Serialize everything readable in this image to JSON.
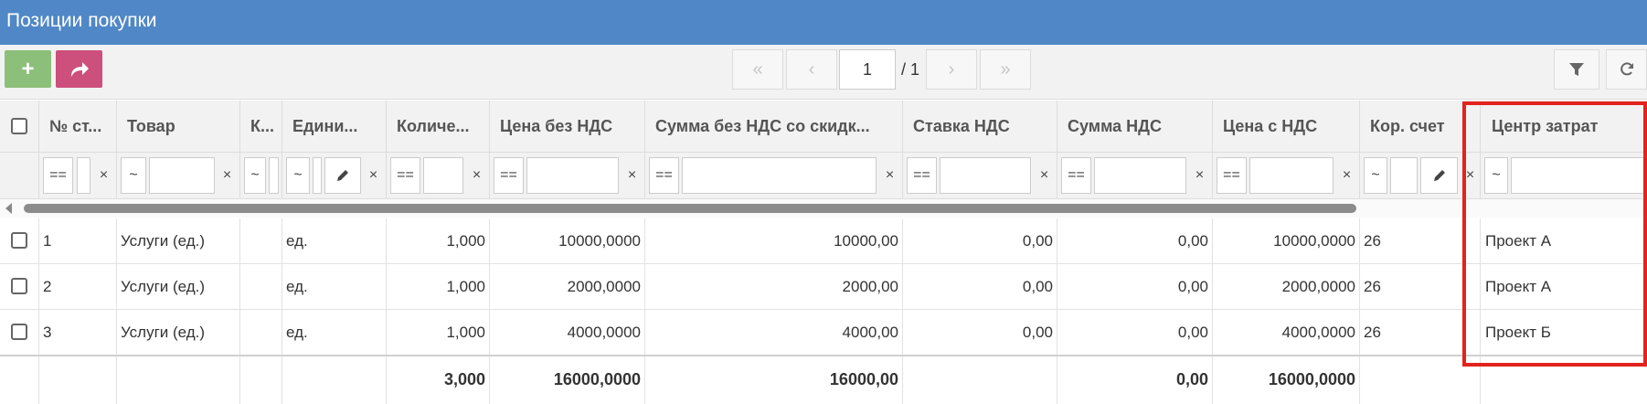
{
  "title": "Позиции покупки",
  "toolbar": {
    "add_symbol": "+",
    "forward_symbol": "↱",
    "pager": {
      "first": "«",
      "prev": "‹",
      "page": "1",
      "total": "/ 1",
      "next": "›",
      "last": "»"
    }
  },
  "columns": [
    "№ ст...",
    "Товар",
    "К...",
    "Едини...",
    "Количе...",
    "Цена без НДС",
    "Сумма без НДС со скидк...",
    "Ставка НДС",
    "Сумма НДС",
    "Цена с НДС",
    "Кор. счет",
    "Центр затрат"
  ],
  "filters": {
    "eq": "==",
    "like": "~",
    "clear": "×"
  },
  "rows": [
    {
      "num": "1",
      "item": "Услуги (ед.)",
      "k": "",
      "unit": "ед.",
      "qty": "1,000",
      "price": "10000,0000",
      "sum": "10000,00",
      "rate": "0,00",
      "vat": "0,00",
      "price_vat": "10000,0000",
      "account": "26",
      "cost_center": "Проект А"
    },
    {
      "num": "2",
      "item": "Услуги (ед.)",
      "k": "",
      "unit": "ед.",
      "qty": "1,000",
      "price": "2000,0000",
      "sum": "2000,00",
      "rate": "0,00",
      "vat": "0,00",
      "price_vat": "2000,0000",
      "account": "26",
      "cost_center": "Проект А"
    },
    {
      "num": "3",
      "item": "Услуги (ед.)",
      "k": "",
      "unit": "ед.",
      "qty": "1,000",
      "price": "4000,0000",
      "sum": "4000,00",
      "rate": "0,00",
      "vat": "0,00",
      "price_vat": "4000,0000",
      "account": "26",
      "cost_center": "Проект Б"
    }
  ],
  "totals": {
    "qty": "3,000",
    "price": "16000,0000",
    "sum": "16000,00",
    "vat": "0,00",
    "price_vat": "16000,0000"
  },
  "colors": {
    "header": "#5087c7",
    "add": "#8cbf7a",
    "forward": "#cc4f7c",
    "highlight": "#e3231d"
  }
}
